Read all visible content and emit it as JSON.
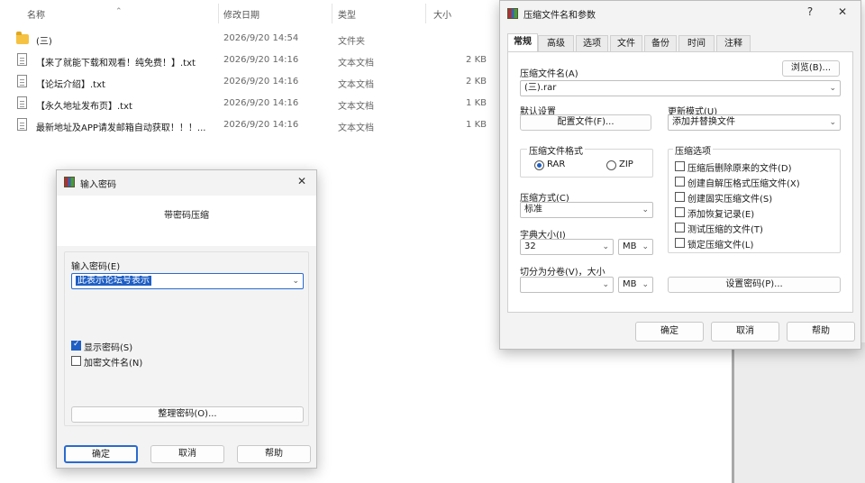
{
  "explorer": {
    "columns": {
      "name": "名称",
      "date": "修改日期",
      "type": "类型",
      "size": "大小"
    },
    "files": [
      {
        "name": "(三)",
        "date": "2026/9/20 14:54",
        "type": "文件夹",
        "size": "",
        "icon": "folder-icon"
      },
      {
        "name": "【来了就能下载和观看！纯免费！】.txt",
        "date": "2026/9/20 14:16",
        "type": "文本文档",
        "size": "2 KB",
        "icon": "text-file-icon"
      },
      {
        "name": "【论坛介绍】.txt",
        "date": "2026/9/20 14:16",
        "type": "文本文档",
        "size": "2 KB",
        "icon": "text-file-icon"
      },
      {
        "name": "【永久地址发布页】.txt",
        "date": "2026/9/20 14:16",
        "type": "文本文档",
        "size": "1 KB",
        "icon": "text-file-icon"
      },
      {
        "name": "最新地址及APP请发邮箱自动获取！！！...",
        "date": "2026/9/20 14:16",
        "type": "文本文档",
        "size": "1 KB",
        "icon": "text-file-icon"
      }
    ]
  },
  "archive_dialog": {
    "title": "压缩文件名和参数",
    "help_glyph": "?",
    "close_glyph": "✕",
    "tabs": [
      "常规",
      "高级",
      "选项",
      "文件",
      "备份",
      "时间",
      "注释"
    ],
    "archive_name_label": "压缩文件名(A)",
    "browse_button": "浏览(B)...",
    "archive_name_value": "(三).rar",
    "default_settings_label": "默认设置",
    "profiles_button": "配置文件(F)...",
    "update_mode_label": "更新模式(U)",
    "update_mode_value": "添加并替换文件",
    "format_group": "压缩文件格式",
    "format_rar": "RAR",
    "format_zip": "ZIP",
    "method_label": "压缩方式(C)",
    "method_value": "标准",
    "dict_label": "字典大小(I)",
    "dict_value": "32",
    "dict_unit": "MB",
    "split_label": "切分为分卷(V)，大小",
    "split_value": "",
    "split_unit": "MB",
    "options_group": "压缩选项",
    "options": [
      {
        "label": "压缩后删除原来的文件(D)",
        "checked": false
      },
      {
        "label": "创建自解压格式压缩文件(X)",
        "checked": false
      },
      {
        "label": "创建固实压缩文件(S)",
        "checked": false
      },
      {
        "label": "添加恢复记录(E)",
        "checked": false
      },
      {
        "label": "测试压缩的文件(T)",
        "checked": false
      },
      {
        "label": "锁定压缩文件(L)",
        "checked": false
      }
    ],
    "set_password_button": "设置密码(P)...",
    "ok_button": "确定",
    "cancel_button": "取消",
    "help_button": "帮助"
  },
  "password_dialog": {
    "title": "输入密码",
    "close_glyph": "✕",
    "heading": "带密码压缩",
    "password_label": "输入密码(E)",
    "password_value": "此表示论坛号表示",
    "show_password_label": "显示密码(S)",
    "show_password_checked": true,
    "encrypt_names_label": "加密文件名(N)",
    "encrypt_names_checked": false,
    "organize_button": "整理密码(O)...",
    "ok_button": "确定",
    "cancel_button": "取消",
    "help_button": "帮助"
  },
  "colors": {
    "accent": "#1f5fc4",
    "selection": "#1f5fc4",
    "dialog_bg": "#f3f3f3"
  }
}
